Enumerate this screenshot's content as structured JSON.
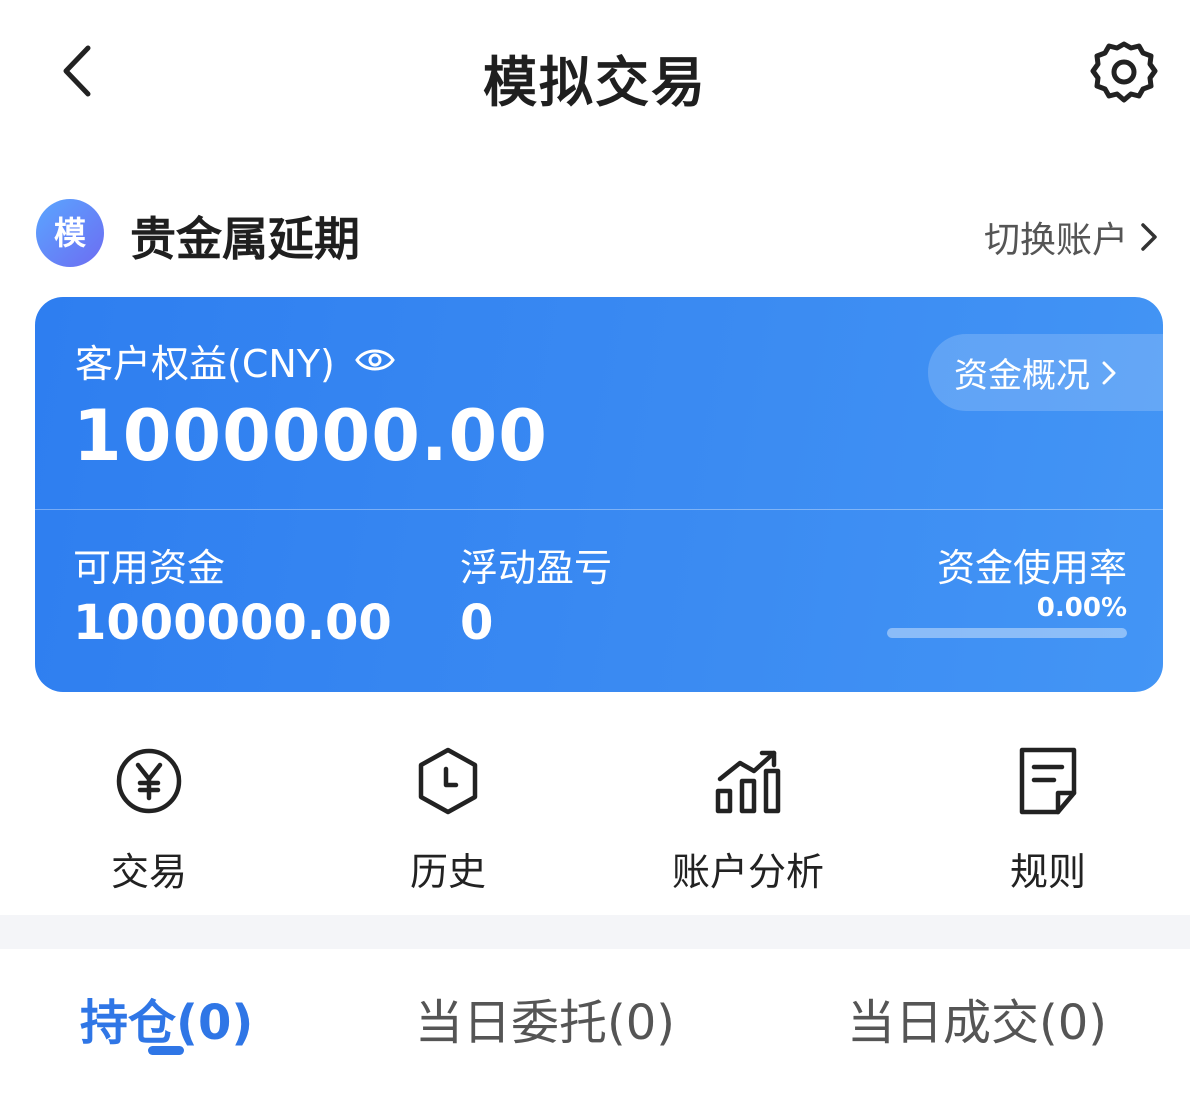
{
  "header": {
    "title": "模拟交易",
    "back_icon": "chevron-left-icon",
    "settings_icon": "gear-icon"
  },
  "account": {
    "avatar_text": "模",
    "name": "贵金属延期",
    "switch_label": "切换账户"
  },
  "card": {
    "equity_label": "客户权益(CNY)",
    "equity_value": "1000000.00",
    "funds_button": "资金概况",
    "available_label": "可用资金",
    "available_value": "1000000.00",
    "float_label": "浮动盈亏",
    "float_value": "0",
    "usage_label": "资金使用率",
    "usage_value": "0.00%",
    "usage_fraction": 0,
    "colors": {
      "card_start": "#2e7ef0",
      "card_end": "#4395f5"
    }
  },
  "actions": [
    {
      "label": "交易",
      "icon": "yen-circle-icon"
    },
    {
      "label": "历史",
      "icon": "history-clock-icon"
    },
    {
      "label": "账户分析",
      "icon": "bar-chart-trend-icon"
    },
    {
      "label": "规则",
      "icon": "rules-document-icon"
    }
  ],
  "tabs": [
    {
      "label": "持仓(0)",
      "active": true
    },
    {
      "label": "当日委托(0)",
      "active": false
    },
    {
      "label": "当日成交(0)",
      "active": false
    }
  ],
  "colors": {
    "accent": "#2f76e6",
    "text": "#222222"
  }
}
